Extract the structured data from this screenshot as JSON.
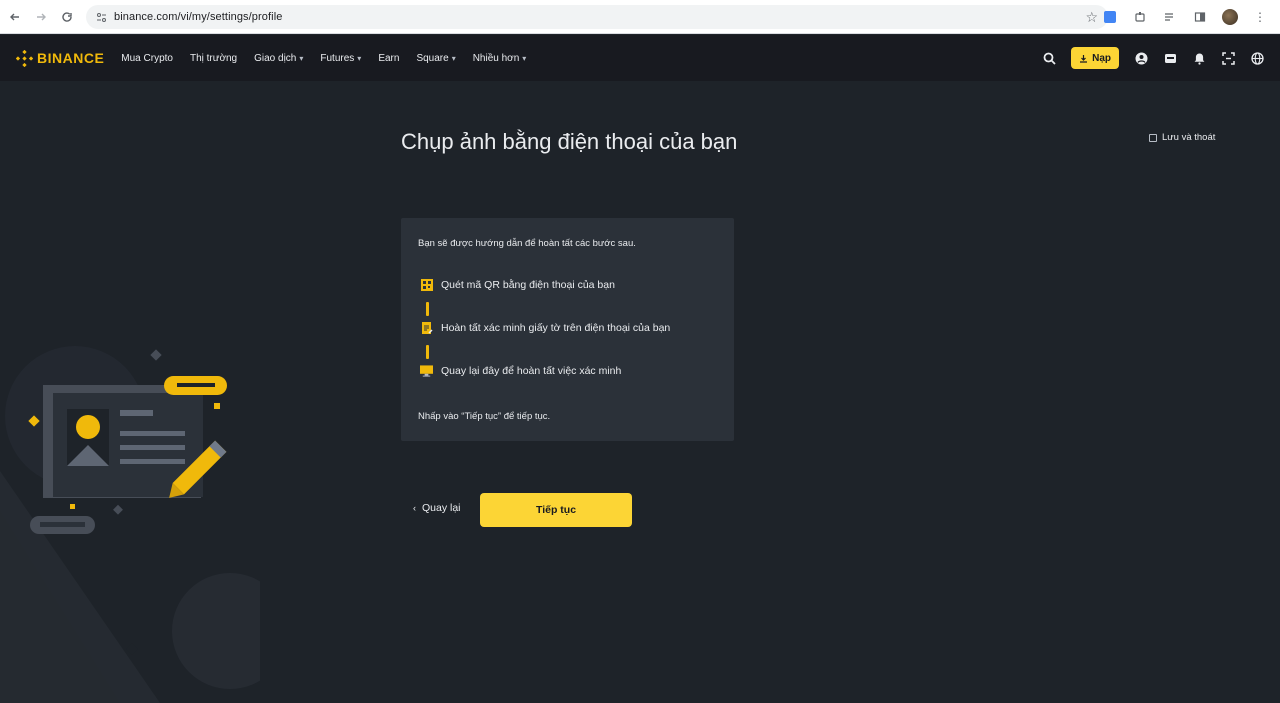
{
  "browser": {
    "url": "binance.com/vi/my/settings/profile",
    "nav": {
      "back": "back-arrow-icon",
      "forward": "forward-arrow-icon",
      "reload": "reload-icon"
    }
  },
  "header": {
    "logo_text": "BINANCE",
    "menu": [
      {
        "label": "Mua Crypto",
        "has_dropdown": false
      },
      {
        "label": "Thị trường",
        "has_dropdown": false
      },
      {
        "label": "Giao dịch",
        "has_dropdown": true
      },
      {
        "label": "Futures",
        "has_dropdown": true
      },
      {
        "label": "Earn",
        "has_dropdown": false
      },
      {
        "label": "Square",
        "has_dropdown": true
      },
      {
        "label": "Nhiều hơn",
        "has_dropdown": true
      }
    ],
    "deposit_label": "Nạp"
  },
  "page": {
    "title": "Chụp ảnh bằng điện thoại của bạn",
    "save_exit": "Lưu và thoát",
    "card": {
      "intro": "Bạn sẽ được hướng dẫn để hoàn tất các bước sau.",
      "steps": [
        "Quét mã QR bằng điện thoại của bạn",
        "Hoàn tất xác minh giấy tờ trên điện thoại của bạn",
        "Quay lại đây để hoàn tất việc xác minh"
      ],
      "footnote": "Nhấp vào “Tiếp tục” để tiếp tục."
    },
    "back_label": "Quay lại",
    "continue_label": "Tiếp tục"
  },
  "colors": {
    "brand": "#f0b90b",
    "button": "#fcd535",
    "background": "#1e2329",
    "header": "#181a20",
    "card": "#2b3139"
  }
}
